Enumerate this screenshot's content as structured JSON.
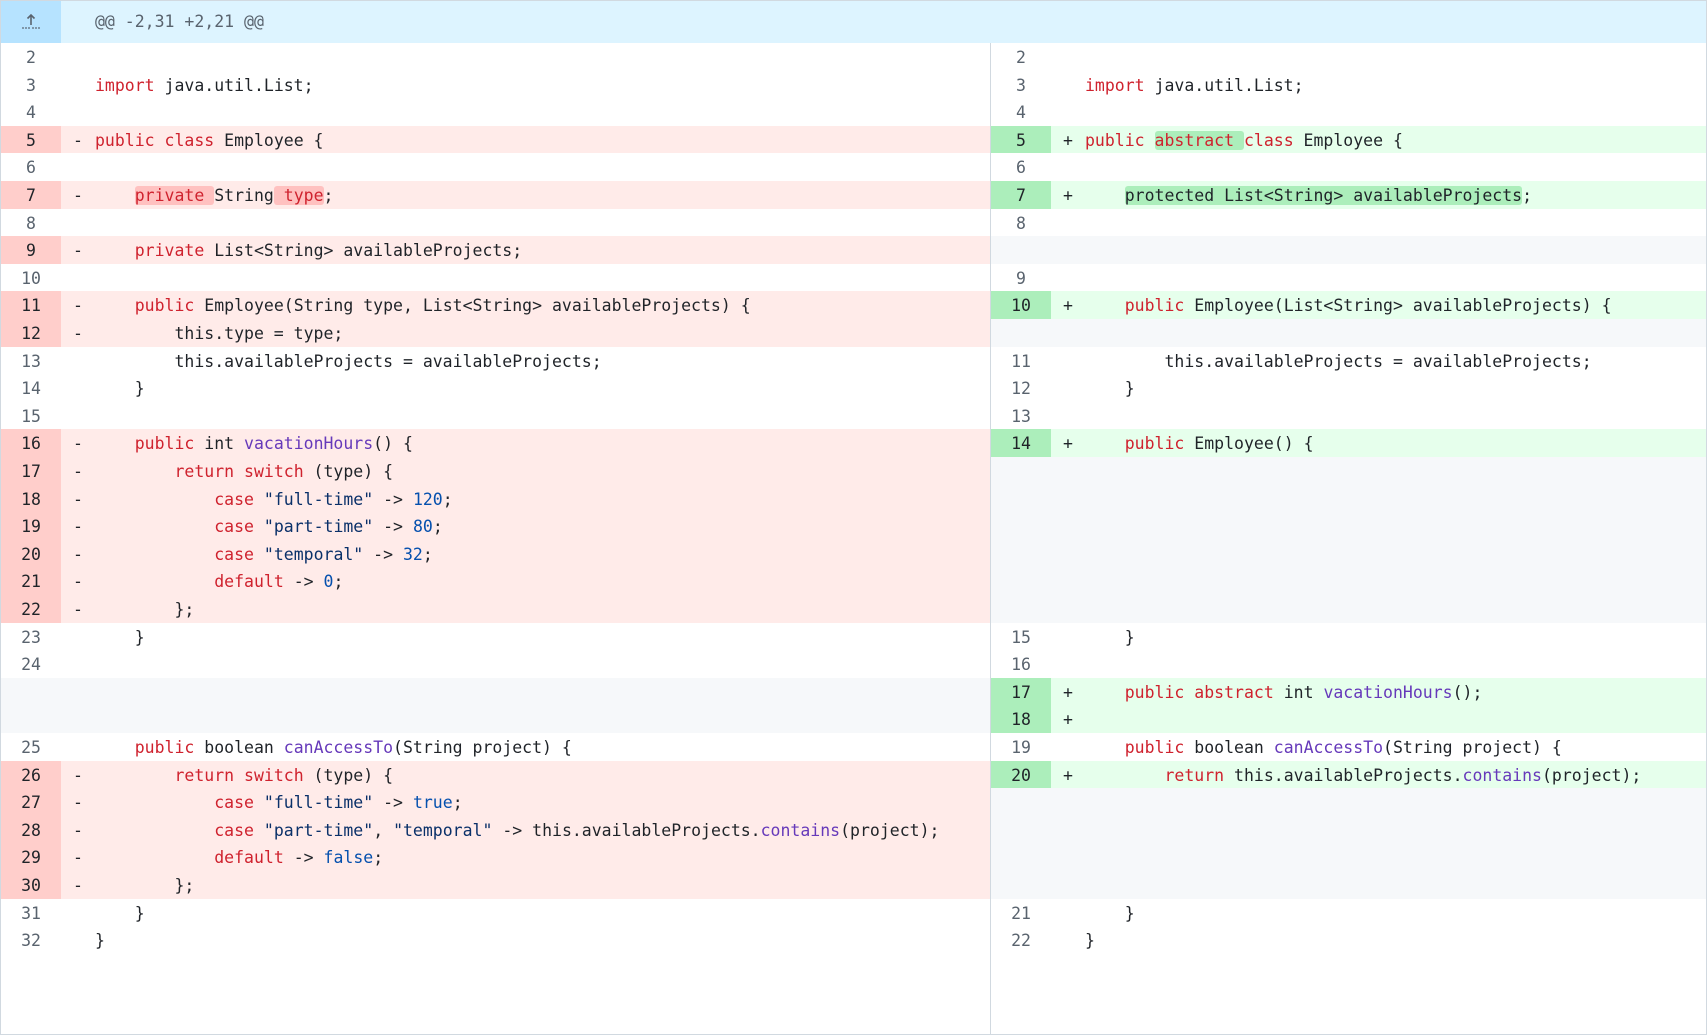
{
  "hunk": {
    "header": "@@ -2,31 +2,21 @@",
    "expand_icon": "expand-up-icon"
  },
  "colors": {
    "deletion_bg": "#ffebe9",
    "deletion_num_bg": "#ffcecb",
    "addition_bg": "#e6ffec",
    "addition_num_bg": "#aceebb",
    "hunk_bg": "#ddf4ff",
    "empty_bg": "#f6f8fa",
    "keyword": "#cf222e",
    "function": "#6639ba",
    "constant": "#0550ae",
    "string": "#0a3069"
  },
  "rows": [
    {
      "l": {
        "n": "2",
        "k": "ctx",
        "m": "",
        "t": [
          {
            "s": "",
            "c": "pl"
          }
        ]
      },
      "r": {
        "n": "2",
        "k": "ctx",
        "m": "",
        "t": [
          {
            "s": "",
            "c": "pl"
          }
        ]
      }
    },
    {
      "l": {
        "n": "3",
        "k": "ctx",
        "m": "",
        "t": [
          {
            "s": "import",
            "c": "kw"
          },
          {
            "s": " java.util.List;",
            "c": "pl"
          }
        ]
      },
      "r": {
        "n": "3",
        "k": "ctx",
        "m": "",
        "t": [
          {
            "s": "import",
            "c": "kw"
          },
          {
            "s": " java.util.List;",
            "c": "pl"
          }
        ]
      }
    },
    {
      "l": {
        "n": "4",
        "k": "ctx",
        "m": "",
        "t": [
          {
            "s": "",
            "c": "pl"
          }
        ]
      },
      "r": {
        "n": "4",
        "k": "ctx",
        "m": "",
        "t": [
          {
            "s": "",
            "c": "pl"
          }
        ]
      }
    },
    {
      "l": {
        "n": "5",
        "k": "del",
        "m": "-",
        "t": [
          {
            "s": "public",
            "c": "kw"
          },
          {
            "s": " ",
            "c": "pl"
          },
          {
            "s": "class",
            "c": "kw"
          },
          {
            "s": " Employee {",
            "c": "pl"
          }
        ]
      },
      "r": {
        "n": "5",
        "k": "add",
        "m": "+",
        "t": [
          {
            "s": "public",
            "c": "kw"
          },
          {
            "s": " ",
            "c": "pl"
          },
          {
            "s": "abstract ",
            "c": "kw",
            "w": true
          },
          {
            "s": "class",
            "c": "kw"
          },
          {
            "s": " Employee {",
            "c": "pl"
          }
        ]
      }
    },
    {
      "l": {
        "n": "6",
        "k": "ctx",
        "m": "",
        "t": [
          {
            "s": "",
            "c": "pl"
          }
        ]
      },
      "r": {
        "n": "6",
        "k": "ctx",
        "m": "",
        "t": [
          {
            "s": "",
            "c": "pl"
          }
        ]
      }
    },
    {
      "l": {
        "n": "7",
        "k": "del",
        "m": "-",
        "t": [
          {
            "s": "    ",
            "c": "pl"
          },
          {
            "s": "private ",
            "c": "kw",
            "w": true
          },
          {
            "s": "String",
            "c": "pl"
          },
          {
            "s": " type",
            "c": "kw",
            "w": true
          },
          {
            "s": ";",
            "c": "pl"
          }
        ]
      },
      "r": {
        "n": "7",
        "k": "add",
        "m": "+",
        "t": [
          {
            "s": "    ",
            "c": "pl"
          },
          {
            "s": "protected List<String> availableProjects",
            "c": "pl",
            "w": true
          },
          {
            "s": ";",
            "c": "pl"
          }
        ]
      }
    },
    {
      "l": {
        "n": "8",
        "k": "ctx",
        "m": "",
        "t": [
          {
            "s": "",
            "c": "pl"
          }
        ]
      },
      "r": {
        "n": "8",
        "k": "ctx",
        "m": "",
        "t": [
          {
            "s": "",
            "c": "pl"
          }
        ]
      }
    },
    {
      "l": {
        "n": "9",
        "k": "del",
        "m": "-",
        "t": [
          {
            "s": "    ",
            "c": "pl"
          },
          {
            "s": "private",
            "c": "kw"
          },
          {
            "s": " List<String> availableProjects;",
            "c": "pl"
          }
        ]
      },
      "r": {
        "n": "",
        "k": "empty",
        "m": "",
        "t": []
      }
    },
    {
      "l": {
        "n": "10",
        "k": "ctx",
        "m": "",
        "t": [
          {
            "s": "",
            "c": "pl"
          }
        ]
      },
      "r": {
        "n": "9",
        "k": "ctx",
        "m": "",
        "t": [
          {
            "s": "",
            "c": "pl"
          }
        ]
      }
    },
    {
      "l": {
        "n": "11",
        "k": "del",
        "m": "-",
        "t": [
          {
            "s": "    ",
            "c": "pl"
          },
          {
            "s": "public",
            "c": "kw"
          },
          {
            "s": " Employee(String type, List<String> availableProjects) {",
            "c": "pl"
          }
        ]
      },
      "r": {
        "n": "10",
        "k": "add",
        "m": "+",
        "t": [
          {
            "s": "    ",
            "c": "pl"
          },
          {
            "s": "public",
            "c": "kw"
          },
          {
            "s": " Employee(List<String> availableProjects) {",
            "c": "pl"
          }
        ]
      }
    },
    {
      "l": {
        "n": "12",
        "k": "del",
        "m": "-",
        "t": [
          {
            "s": "        this.type = type;",
            "c": "pl"
          }
        ]
      },
      "r": {
        "n": "",
        "k": "empty",
        "m": "",
        "t": []
      }
    },
    {
      "l": {
        "n": "13",
        "k": "ctx",
        "m": "",
        "t": [
          {
            "s": "        this.availableProjects = availableProjects;",
            "c": "pl"
          }
        ]
      },
      "r": {
        "n": "11",
        "k": "ctx",
        "m": "",
        "t": [
          {
            "s": "        this.availableProjects = availableProjects;",
            "c": "pl"
          }
        ]
      }
    },
    {
      "l": {
        "n": "14",
        "k": "ctx",
        "m": "",
        "t": [
          {
            "s": "    }",
            "c": "pl"
          }
        ]
      },
      "r": {
        "n": "12",
        "k": "ctx",
        "m": "",
        "t": [
          {
            "s": "    }",
            "c": "pl"
          }
        ]
      }
    },
    {
      "l": {
        "n": "15",
        "k": "ctx",
        "m": "",
        "t": [
          {
            "s": "",
            "c": "pl"
          }
        ]
      },
      "r": {
        "n": "13",
        "k": "ctx",
        "m": "",
        "t": [
          {
            "s": "",
            "c": "pl"
          }
        ]
      }
    },
    {
      "l": {
        "n": "16",
        "k": "del",
        "m": "-",
        "t": [
          {
            "s": "    ",
            "c": "pl"
          },
          {
            "s": "public",
            "c": "kw"
          },
          {
            "s": " int ",
            "c": "pl"
          },
          {
            "s": "vacationHours",
            "c": "fn"
          },
          {
            "s": "() {",
            "c": "pl"
          }
        ]
      },
      "r": {
        "n": "14",
        "k": "add",
        "m": "+",
        "t": [
          {
            "s": "    ",
            "c": "pl"
          },
          {
            "s": "public",
            "c": "kw"
          },
          {
            "s": " Employee() {",
            "c": "pl"
          }
        ]
      }
    },
    {
      "l": {
        "n": "17",
        "k": "del",
        "m": "-",
        "t": [
          {
            "s": "        ",
            "c": "pl"
          },
          {
            "s": "return switch",
            "c": "kw"
          },
          {
            "s": " (type) {",
            "c": "pl"
          }
        ]
      },
      "r": {
        "n": "",
        "k": "empty",
        "m": "",
        "t": []
      }
    },
    {
      "l": {
        "n": "18",
        "k": "del",
        "m": "-",
        "t": [
          {
            "s": "            ",
            "c": "pl"
          },
          {
            "s": "case",
            "c": "kw"
          },
          {
            "s": " ",
            "c": "pl"
          },
          {
            "s": "\"full-time\"",
            "c": "st"
          },
          {
            "s": " -> ",
            "c": "pl"
          },
          {
            "s": "120",
            "c": "cn"
          },
          {
            "s": ";",
            "c": "pl"
          }
        ]
      },
      "r": {
        "n": "",
        "k": "empty",
        "m": "",
        "t": []
      }
    },
    {
      "l": {
        "n": "19",
        "k": "del",
        "m": "-",
        "t": [
          {
            "s": "            ",
            "c": "pl"
          },
          {
            "s": "case",
            "c": "kw"
          },
          {
            "s": " ",
            "c": "pl"
          },
          {
            "s": "\"part-time\"",
            "c": "st"
          },
          {
            "s": " -> ",
            "c": "pl"
          },
          {
            "s": "80",
            "c": "cn"
          },
          {
            "s": ";",
            "c": "pl"
          }
        ]
      },
      "r": {
        "n": "",
        "k": "empty",
        "m": "",
        "t": []
      }
    },
    {
      "l": {
        "n": "20",
        "k": "del",
        "m": "-",
        "t": [
          {
            "s": "            ",
            "c": "pl"
          },
          {
            "s": "case",
            "c": "kw"
          },
          {
            "s": " ",
            "c": "pl"
          },
          {
            "s": "\"temporal\"",
            "c": "st"
          },
          {
            "s": " -> ",
            "c": "pl"
          },
          {
            "s": "32",
            "c": "cn"
          },
          {
            "s": ";",
            "c": "pl"
          }
        ]
      },
      "r": {
        "n": "",
        "k": "empty",
        "m": "",
        "t": []
      }
    },
    {
      "l": {
        "n": "21",
        "k": "del",
        "m": "-",
        "t": [
          {
            "s": "            ",
            "c": "pl"
          },
          {
            "s": "default",
            "c": "kw"
          },
          {
            "s": " -> ",
            "c": "pl"
          },
          {
            "s": "0",
            "c": "cn"
          },
          {
            "s": ";",
            "c": "pl"
          }
        ]
      },
      "r": {
        "n": "",
        "k": "empty",
        "m": "",
        "t": []
      }
    },
    {
      "l": {
        "n": "22",
        "k": "del",
        "m": "-",
        "t": [
          {
            "s": "        };",
            "c": "pl"
          }
        ]
      },
      "r": {
        "n": "",
        "k": "empty",
        "m": "",
        "t": []
      }
    },
    {
      "l": {
        "n": "23",
        "k": "ctx",
        "m": "",
        "t": [
          {
            "s": "    }",
            "c": "pl"
          }
        ]
      },
      "r": {
        "n": "15",
        "k": "ctx",
        "m": "",
        "t": [
          {
            "s": "    }",
            "c": "pl"
          }
        ]
      }
    },
    {
      "l": {
        "n": "24",
        "k": "ctx",
        "m": "",
        "t": [
          {
            "s": "",
            "c": "pl"
          }
        ]
      },
      "r": {
        "n": "16",
        "k": "ctx",
        "m": "",
        "t": [
          {
            "s": "",
            "c": "pl"
          }
        ]
      }
    },
    {
      "l": {
        "n": "",
        "k": "empty",
        "m": "",
        "t": []
      },
      "r": {
        "n": "17",
        "k": "add",
        "m": "+",
        "t": [
          {
            "s": "    ",
            "c": "pl"
          },
          {
            "s": "public abstract",
            "c": "kw"
          },
          {
            "s": " int ",
            "c": "pl"
          },
          {
            "s": "vacationHours",
            "c": "fn"
          },
          {
            "s": "();",
            "c": "pl"
          }
        ]
      }
    },
    {
      "l": {
        "n": "",
        "k": "empty",
        "m": "",
        "t": []
      },
      "r": {
        "n": "18",
        "k": "add",
        "m": "+",
        "t": [
          {
            "s": "",
            "c": "pl"
          }
        ]
      }
    },
    {
      "l": {
        "n": "25",
        "k": "ctx",
        "m": "",
        "t": [
          {
            "s": "    ",
            "c": "pl"
          },
          {
            "s": "public",
            "c": "kw"
          },
          {
            "s": " boolean ",
            "c": "pl"
          },
          {
            "s": "canAccessTo",
            "c": "fn"
          },
          {
            "s": "(String project) {",
            "c": "pl"
          }
        ]
      },
      "r": {
        "n": "19",
        "k": "ctx",
        "m": "",
        "t": [
          {
            "s": "    ",
            "c": "pl"
          },
          {
            "s": "public",
            "c": "kw"
          },
          {
            "s": " boolean ",
            "c": "pl"
          },
          {
            "s": "canAccessTo",
            "c": "fn"
          },
          {
            "s": "(String project) {",
            "c": "pl"
          }
        ]
      }
    },
    {
      "l": {
        "n": "26",
        "k": "del",
        "m": "-",
        "t": [
          {
            "s": "        ",
            "c": "pl"
          },
          {
            "s": "return switch",
            "c": "kw"
          },
          {
            "s": " (type) {",
            "c": "pl"
          }
        ]
      },
      "r": {
        "n": "20",
        "k": "add",
        "m": "+",
        "t": [
          {
            "s": "        ",
            "c": "pl"
          },
          {
            "s": "return",
            "c": "kw"
          },
          {
            "s": " this.availableProjects.",
            "c": "pl"
          },
          {
            "s": "contains",
            "c": "fn"
          },
          {
            "s": "(project);",
            "c": "pl"
          }
        ]
      }
    },
    {
      "l": {
        "n": "27",
        "k": "del",
        "m": "-",
        "t": [
          {
            "s": "            ",
            "c": "pl"
          },
          {
            "s": "case",
            "c": "kw"
          },
          {
            "s": " ",
            "c": "pl"
          },
          {
            "s": "\"full-time\"",
            "c": "st"
          },
          {
            "s": " -> ",
            "c": "pl"
          },
          {
            "s": "true",
            "c": "cn"
          },
          {
            "s": ";",
            "c": "pl"
          }
        ]
      },
      "r": {
        "n": "",
        "k": "empty",
        "m": "",
        "t": []
      }
    },
    {
      "l": {
        "n": "28",
        "k": "del",
        "m": "-",
        "t": [
          {
            "s": "            ",
            "c": "pl"
          },
          {
            "s": "case",
            "c": "kw"
          },
          {
            "s": " ",
            "c": "pl"
          },
          {
            "s": "\"part-time\"",
            "c": "st"
          },
          {
            "s": ", ",
            "c": "pl"
          },
          {
            "s": "\"temporal\"",
            "c": "st"
          },
          {
            "s": " -> this.availableProjects.",
            "c": "pl"
          },
          {
            "s": "contains",
            "c": "fn"
          },
          {
            "s": "(project);",
            "c": "pl"
          }
        ]
      },
      "r": {
        "n": "",
        "k": "empty",
        "m": "",
        "t": []
      }
    },
    {
      "l": {
        "n": "29",
        "k": "del",
        "m": "-",
        "t": [
          {
            "s": "            ",
            "c": "pl"
          },
          {
            "s": "default",
            "c": "kw"
          },
          {
            "s": " -> ",
            "c": "pl"
          },
          {
            "s": "false",
            "c": "cn"
          },
          {
            "s": ";",
            "c": "pl"
          }
        ]
      },
      "r": {
        "n": "",
        "k": "empty",
        "m": "",
        "t": []
      }
    },
    {
      "l": {
        "n": "30",
        "k": "del",
        "m": "-",
        "t": [
          {
            "s": "        };",
            "c": "pl"
          }
        ]
      },
      "r": {
        "n": "",
        "k": "empty",
        "m": "",
        "t": []
      }
    },
    {
      "l": {
        "n": "31",
        "k": "ctx",
        "m": "",
        "t": [
          {
            "s": "    }",
            "c": "pl"
          }
        ]
      },
      "r": {
        "n": "21",
        "k": "ctx",
        "m": "",
        "t": [
          {
            "s": "    }",
            "c": "pl"
          }
        ]
      }
    },
    {
      "l": {
        "n": "32",
        "k": "ctx",
        "m": "",
        "t": [
          {
            "s": "}",
            "c": "pl"
          }
        ]
      },
      "r": {
        "n": "22",
        "k": "ctx",
        "m": "",
        "t": [
          {
            "s": "}",
            "c": "pl"
          }
        ]
      }
    }
  ]
}
